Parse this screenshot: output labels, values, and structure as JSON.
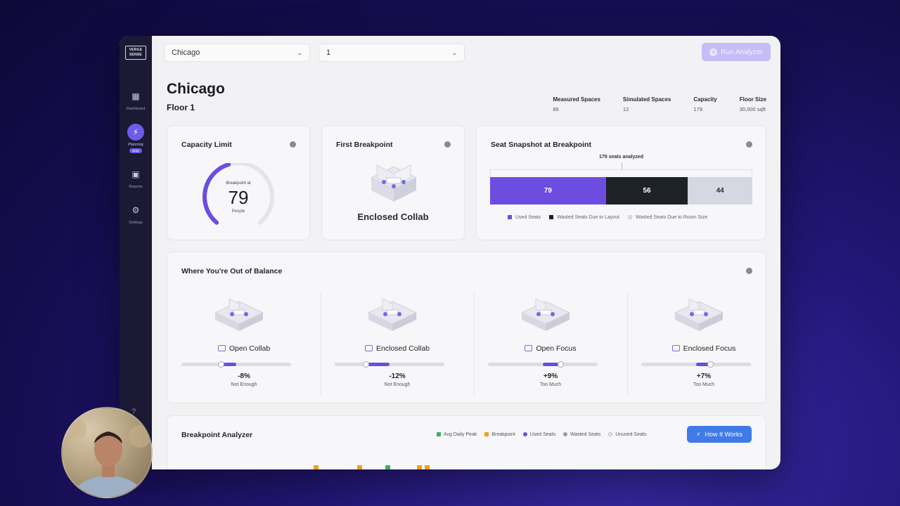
{
  "app": {
    "logo_text": "VERGE SENSE",
    "sidebar": [
      {
        "label": "Dashboard",
        "icon": "dashboard-icon",
        "glyph": "▦",
        "active": false
      },
      {
        "label": "Planning",
        "icon": "bolt-icon",
        "glyph": "⚡",
        "active": true,
        "badge": "Beta"
      },
      {
        "label": "Reports",
        "icon": "reports-icon",
        "glyph": "▣",
        "active": false
      },
      {
        "label": "Settings",
        "icon": "gear-icon",
        "glyph": "⚙",
        "active": false
      }
    ],
    "help_glyph": "?"
  },
  "toolbar": {
    "location_select": "Chicago",
    "floor_select": "1",
    "chevron": "⌄",
    "run_label": "Run Analyzer",
    "run_glyph": "+"
  },
  "header": {
    "title": "Chicago",
    "subtitle": "Floor 1",
    "stats": [
      {
        "label": "Measured Spaces",
        "value": "85"
      },
      {
        "label": "Simulated Spaces",
        "value": "12"
      },
      {
        "label": "Capacity",
        "value": "179"
      },
      {
        "label": "Floor Size",
        "value": "30,000 sqft"
      }
    ]
  },
  "capacity_card": {
    "title": "Capacity Limit",
    "caption": "Breakpoint at",
    "value": "79",
    "unit": "People",
    "fraction": 0.44,
    "accent": "#6c4de0"
  },
  "breakpoint_card": {
    "title": "First Breakpoint",
    "space": "Enclosed Collab"
  },
  "snapshot_card": {
    "title": "Seat Snapshot at Breakpoint",
    "note": "179 seats analyzed",
    "segments": [
      {
        "value": 79,
        "label": "79",
        "color": "#6c4de0",
        "text_color": "#ffffff"
      },
      {
        "value": 56,
        "label": "56",
        "color": "#1d2128",
        "text_color": "#ffffff"
      },
      {
        "value": 44,
        "label": "44",
        "color": "#d6d7e0",
        "text_color": "#2a2a36"
      }
    ],
    "legend": [
      {
        "label": "Used Seats",
        "color": "#6c4de0"
      },
      {
        "label": "Wasted Seats Due to Layout",
        "color": "#1d2128"
      },
      {
        "label": "Wasted Seats Due to Room Size",
        "color": "#d6d7e0"
      }
    ]
  },
  "balance_card": {
    "title": "Where You're Out of Balance",
    "items": [
      {
        "name": "Open Collab",
        "pct": "-8%",
        "state": "Not Enough",
        "value": -8
      },
      {
        "name": "Enclosed Collab",
        "pct": "-12%",
        "state": "Not Enough",
        "value": -12
      },
      {
        "name": "Open Focus",
        "pct": "+9%",
        "state": "Too Much",
        "value": 9
      },
      {
        "name": "Enclosed Focus",
        "pct": "+7%",
        "state": "Too Much",
        "value": 7
      }
    ]
  },
  "analyzer_card": {
    "title": "Breakpoint Analyzer",
    "legend": [
      {
        "label": "Avg Daily Peak",
        "color": "#3fae6a"
      },
      {
        "label": "Breakpoint",
        "color": "#f0a020"
      },
      {
        "label": "Used Seats",
        "color": "#6c4de0"
      },
      {
        "label": "Wasted Seats",
        "color": "#9a9aa6"
      },
      {
        "label": "Unused Seats",
        "color": "#e6e6ec"
      }
    ],
    "how_label": "How It Works",
    "how_glyph": "⚡"
  }
}
